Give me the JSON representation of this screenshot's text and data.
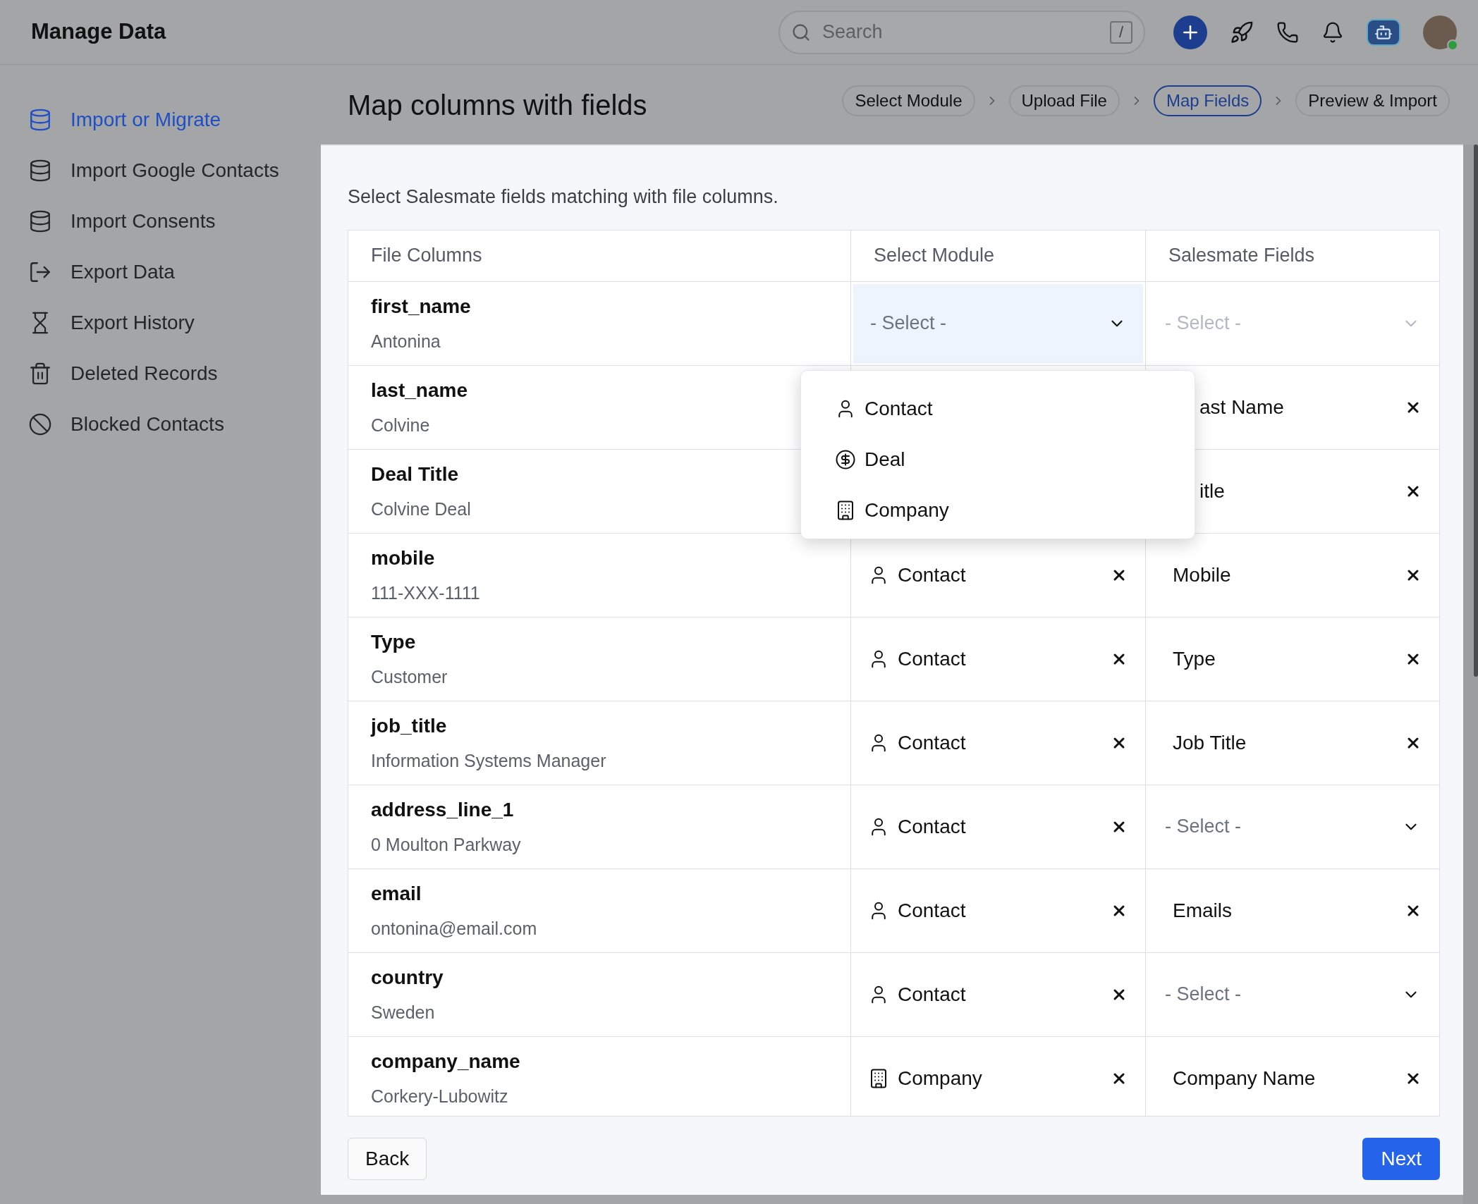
{
  "header": {
    "title": "Manage Data",
    "search": {
      "placeholder": "Search",
      "shortcut": "/"
    }
  },
  "sidebar": {
    "items": [
      {
        "label": "Import or Migrate",
        "kind": "import",
        "selected": true
      },
      {
        "label": "Import Google Contacts",
        "kind": "import",
        "selected": false
      },
      {
        "label": "Import Consents",
        "kind": "import",
        "selected": false
      },
      {
        "label": "Export Data",
        "kind": "export",
        "selected": false
      },
      {
        "label": "Export History",
        "kind": "history",
        "selected": false
      },
      {
        "label": "Deleted Records",
        "kind": "trash",
        "selected": false
      },
      {
        "label": "Blocked Contacts",
        "kind": "blocked",
        "selected": false
      }
    ]
  },
  "page": {
    "title": "Map columns with fields",
    "steps": [
      {
        "label": "Select Module",
        "selected": false
      },
      {
        "label": "Upload File",
        "selected": false
      },
      {
        "label": "Map Fields",
        "selected": true
      },
      {
        "label": "Preview & Import",
        "selected": false
      }
    ],
    "instruction": "Select Salesmate fields matching with file columns."
  },
  "table": {
    "columns": [
      "File Columns",
      "Select Module",
      "Salesmate Fields"
    ],
    "rows": [
      {
        "name": "first_name",
        "sample": "Antonina",
        "module": {
          "kind": "select",
          "text": "- Select -",
          "active": true
        },
        "field": {
          "kind": "select",
          "text": "- Select -",
          "disabled": true
        }
      },
      {
        "name": "last_name",
        "sample": "Colvine",
        "field": {
          "kind": "value",
          "text": "ast Name"
        }
      },
      {
        "name": "Deal Title",
        "sample": "Colvine Deal",
        "field": {
          "kind": "value",
          "text": "itle"
        }
      },
      {
        "name": "mobile",
        "sample": "111-XXX-1111",
        "module": {
          "kind": "contact",
          "text": "Contact"
        },
        "field": {
          "kind": "value",
          "text": "Mobile"
        }
      },
      {
        "name": "Type",
        "sample": "Customer",
        "module": {
          "kind": "contact",
          "text": "Contact"
        },
        "field": {
          "kind": "value",
          "text": "Type"
        }
      },
      {
        "name": "job_title",
        "sample": "Information Systems Manager",
        "module": {
          "kind": "contact",
          "text": "Contact"
        },
        "field": {
          "kind": "value",
          "text": "Job Title"
        }
      },
      {
        "name": "address_line_1",
        "sample": "0 Moulton Parkway",
        "module": {
          "kind": "contact",
          "text": "Contact"
        },
        "field": {
          "kind": "select",
          "text": "- Select -",
          "disabled": false
        }
      },
      {
        "name": "email",
        "sample": "ontonina@email.com",
        "module": {
          "kind": "contact",
          "text": "Contact"
        },
        "field": {
          "kind": "value",
          "text": "Emails"
        }
      },
      {
        "name": "country",
        "sample": "Sweden",
        "module": {
          "kind": "contact",
          "text": "Contact"
        },
        "field": {
          "kind": "select",
          "text": "- Select -",
          "disabled": false
        }
      },
      {
        "name": "company_name",
        "sample": "Corkery-Lubowitz",
        "module": {
          "kind": "company",
          "text": "Company"
        },
        "field": {
          "kind": "value",
          "text": "Company Name"
        }
      }
    ]
  },
  "dropdown": {
    "options": [
      {
        "kind": "contact",
        "label": "Contact"
      },
      {
        "kind": "deal",
        "label": "Deal"
      },
      {
        "kind": "company",
        "label": "Company"
      }
    ]
  },
  "buttons": {
    "back": "Back",
    "next": "Next"
  }
}
